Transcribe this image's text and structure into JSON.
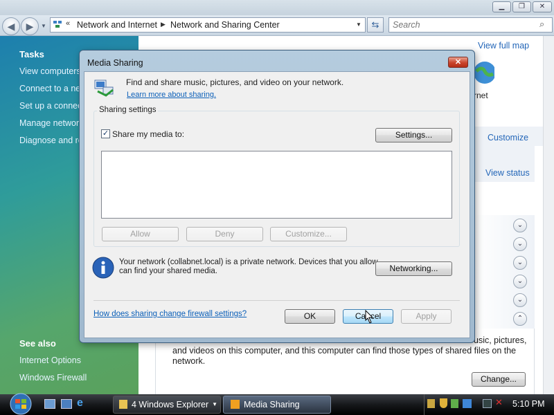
{
  "explorer": {
    "back_icon": "back-arrow-icon",
    "forward_icon": "forward-arrow-icon",
    "breadcrumb_prefix": "«",
    "breadcrumb": [
      "Network and Internet",
      "Network and Sharing Center"
    ],
    "search_placeholder": "Search",
    "view_full_map": "View full map",
    "internet_label": "rnet",
    "customize": "Customize",
    "view_status": "View status",
    "sharing_text": [
      "and videos on this computer, and this computer can find those types of shared files on the",
      "network."
    ],
    "sharing_text_right": "usic, pictures,",
    "change_button": "Change..."
  },
  "sidebar": {
    "tasks_heading": "Tasks",
    "tasks": [
      "View computers",
      "Connect to a ne",
      "Set up a connec",
      "Manage networ",
      "Diagnose and re"
    ],
    "see_also_heading": "See also",
    "see_also": [
      "Internet Options",
      "Windows Firewall"
    ]
  },
  "dialog": {
    "title": "Media Sharing",
    "close_glyph": "✕",
    "description": "Find and share music, pictures, and video on your network.",
    "learn_more": "Learn more about sharing.",
    "group_label": "Sharing settings",
    "share_checkbox_label": "Share my media to:",
    "share_checked": true,
    "settings_button": "Settings...",
    "allow_button": "Allow",
    "deny_button": "Deny",
    "customize_button": "Customize...",
    "info_text_1": "Your network (collabnet.local) is a private network. Devices that you allow",
    "info_text_2": "can find your shared media.",
    "networking_button": "Networking...",
    "firewall_link": "How does sharing change firewall settings?",
    "ok_button": "OK",
    "cancel_button": "Cancel",
    "apply_button": "Apply"
  },
  "taskbar": {
    "start_icon": "windows-orb-icon",
    "explorer_group": "4 Windows Explorer",
    "media_sharing": "Media Sharing",
    "clock": "5:10 PM"
  }
}
